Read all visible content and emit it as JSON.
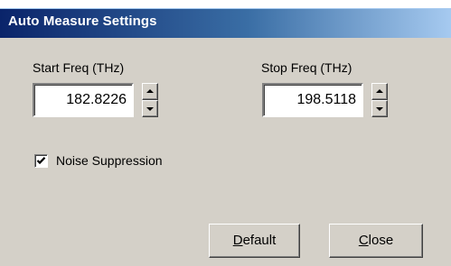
{
  "window": {
    "title": "Auto Measure Settings"
  },
  "start_freq": {
    "label": "Start Freq (THz)",
    "value": "182.8226"
  },
  "stop_freq": {
    "label": "Stop Freq (THz)",
    "value": "198.5118"
  },
  "noise_suppression": {
    "label": "Noise Suppression",
    "checked": true
  },
  "buttons": {
    "default_mnemonic": "D",
    "default_rest": "efault",
    "close_mnemonic": "C",
    "close_rest": "lose"
  },
  "icons": {
    "spin_up": "spin-up-icon",
    "spin_down": "spin-down-icon",
    "check": "checkmark-icon"
  },
  "colors": {
    "titlebar_start": "#0a246a",
    "titlebar_end": "#a6caf0",
    "face": "#d4d0c8"
  }
}
